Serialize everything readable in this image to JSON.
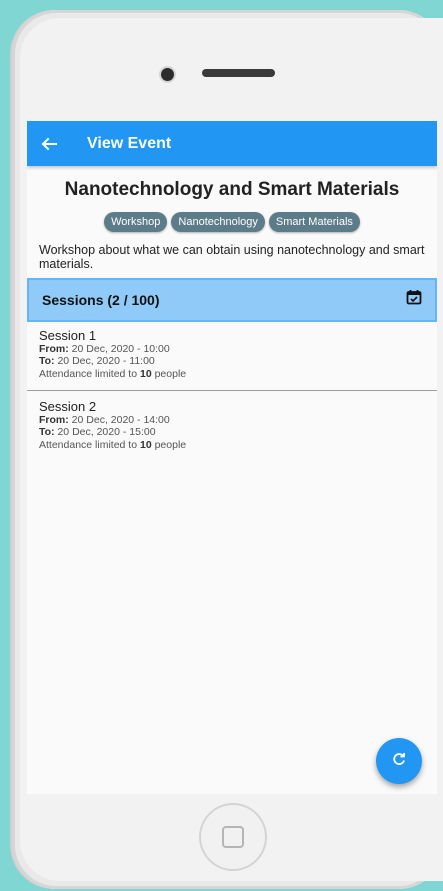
{
  "appbar": {
    "title": "View Event",
    "back_icon": "arrow-left-icon"
  },
  "event": {
    "title": "Nanotechnology and Smart Materials",
    "tags": [
      "Workshop",
      "Nanotechnology",
      "Smart Materials"
    ],
    "description": "Workshop about what we can obtain using nanotechnology and smart materials."
  },
  "sessions_header": {
    "label": "Sessions (2 / 100)",
    "icon": "calendar-check-icon"
  },
  "sessions": [
    {
      "name": "Session 1",
      "from_label": "From:",
      "from_value": "20 Dec, 2020 - 10:00",
      "to_label": "To:",
      "to_value": "20 Dec, 2020 - 11:00",
      "attendance_prefix": "Attendance limited to",
      "attendance_count": "10",
      "attendance_suffix": "people"
    },
    {
      "name": "Session 2",
      "from_label": "From:",
      "from_value": "20 Dec, 2020 - 14:00",
      "to_label": "To:",
      "to_value": "20 Dec, 2020 - 15:00",
      "attendance_prefix": "Attendance limited to",
      "attendance_count": "10",
      "attendance_suffix": "people"
    }
  ],
  "fab": {
    "icon": "refresh-icon"
  },
  "colors": {
    "primary": "#2196f3",
    "header_bg": "#90caf9",
    "tag_bg": "#5d7c8a",
    "background": "#7fd6d3"
  }
}
